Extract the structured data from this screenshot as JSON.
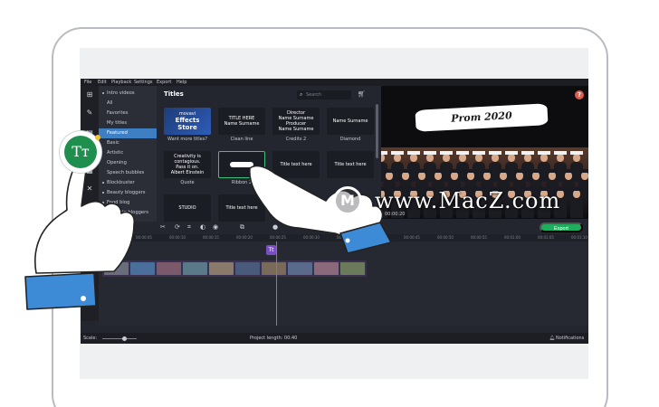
{
  "menu": [
    "File",
    "Edit",
    "Playback",
    "Settings",
    "Export",
    "Help"
  ],
  "categories": [
    {
      "label": "Intro videos",
      "dot": true
    },
    {
      "label": "All",
      "dot": false
    },
    {
      "label": "Favorites",
      "dot": false
    },
    {
      "label": "My titles",
      "dot": false
    },
    {
      "label": "Featured",
      "dot": false,
      "active": true
    },
    {
      "label": "Basic",
      "dot": false
    },
    {
      "label": "Artistic",
      "dot": false
    },
    {
      "label": "Opening",
      "dot": false
    },
    {
      "label": "Speech bubbles",
      "dot": false
    },
    {
      "label": "Blockbuster",
      "dot": true
    },
    {
      "label": "Beauty bloggers",
      "dot": true
    },
    {
      "label": "Food blog",
      "dot": true
    },
    {
      "label": "Lifestyle bloggers",
      "dot": true
    }
  ],
  "titles_panel": {
    "heading": "Titles",
    "search_placeholder": "Search",
    "tiles": [
      {
        "label": "Want more titles?",
        "lines": [
          "movavi",
          "Effects",
          "Store"
        ]
      },
      {
        "label": "Clean line",
        "lines": [
          "TITLE HERE",
          "Name Surname"
        ]
      },
      {
        "label": "Credits 2",
        "lines": [
          "Director",
          "Name Surname",
          "Producer",
          "Name Surname"
        ]
      },
      {
        "label": "Diamond",
        "lines": [
          "Name Surname"
        ]
      },
      {
        "label": "Quote",
        "lines": [
          "Creativity is contagious.",
          "Pass it on.",
          "Albert Einstein"
        ]
      },
      {
        "label": "Ribbon 2",
        "lines": [
          ""
        ]
      },
      {
        "label": "",
        "lines": [
          "Title text here"
        ]
      },
      {
        "label": "",
        "lines": [
          "Title text here"
        ]
      },
      {
        "label": "",
        "lines": [
          "STUDIO"
        ]
      },
      {
        "label": "",
        "lines": [
          "Title text here"
        ]
      }
    ]
  },
  "preview": {
    "banner_text": "Prom 2020",
    "time": "00:00:20"
  },
  "toolbar": {
    "export_label": "Export"
  },
  "ruler_ticks": [
    "00:00:00",
    "00:00:05",
    "00:00:10",
    "00:00:15",
    "00:00:20",
    "00:00:25",
    "00:00:30",
    "00:00:35",
    "00:00:40",
    "00:00:45",
    "00:00:50",
    "00:00:55",
    "00:01:00",
    "00:01:05",
    "00:01:10"
  ],
  "timeline": {
    "title_clip_glyph": "Tt",
    "clip_colors": [
      "#6a6e7a",
      "#4a6f9a",
      "#7a5a6a",
      "#5a7a8a",
      "#8a7a6a",
      "#4a5a7a",
      "#7a6a5a",
      "#5a6a8a",
      "#8a6a7a",
      "#6a7a5a"
    ]
  },
  "statusbar": {
    "scale_label": "Scale:",
    "project_length": "Project length: 00:40",
    "notifications": "Notifications"
  },
  "badge": {
    "glyph": "Tт"
  },
  "watermark": {
    "logo": "M",
    "text": "www.MacZ.com"
  },
  "colors": {
    "accent_blue": "#3d7fc2",
    "export_green": "#1fae5e",
    "tt_green": "#1f8f4e",
    "playhead_red": "#e05a4a",
    "hand_blue": "#3d8ad6"
  }
}
